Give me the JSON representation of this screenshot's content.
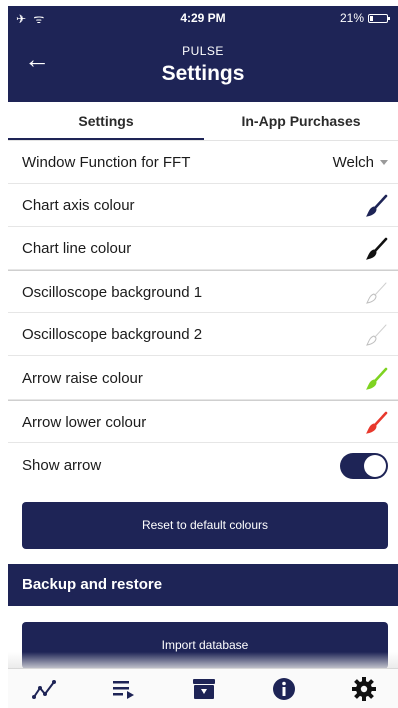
{
  "status_bar": {
    "left_icons": "✈ ᯤ",
    "time": "4:29 PM",
    "battery": "21%",
    "battery_level": 0.21
  },
  "header": {
    "back_icon": "←",
    "subtitle": "PULSE",
    "title": "Settings"
  },
  "tabs": [
    {
      "label": "Settings",
      "active": true
    },
    {
      "label": "In-App Purchases",
      "active": false
    }
  ],
  "settings": {
    "fft": {
      "label": "Window Function for FFT",
      "value": "Welch"
    },
    "chart_axis": {
      "label": "Chart axis colour",
      "color": "#1e2456"
    },
    "chart_line": {
      "label": "Chart line colour",
      "color": "#111111"
    },
    "osc_bg1": {
      "label": "Oscilloscope background 1",
      "color": "#ffffff"
    },
    "osc_bg2": {
      "label": "Oscilloscope background 2",
      "color": "#ffffff"
    },
    "arrow_raise": {
      "label": "Arrow raise colour",
      "color": "#7ed321"
    },
    "arrow_lower": {
      "label": "Arrow lower colour",
      "color": "#e8392d"
    },
    "show_arrow": {
      "label": "Show arrow",
      "on": true
    }
  },
  "reset_button": "Reset to default colours",
  "backup": {
    "section_title": "Backup and restore",
    "import_button": "Import database"
  },
  "bottom_tabs": [
    "chart-icon",
    "playlist-icon",
    "archive-icon",
    "info-icon",
    "gear-icon"
  ],
  "colors": {
    "primary": "#1e2456"
  }
}
